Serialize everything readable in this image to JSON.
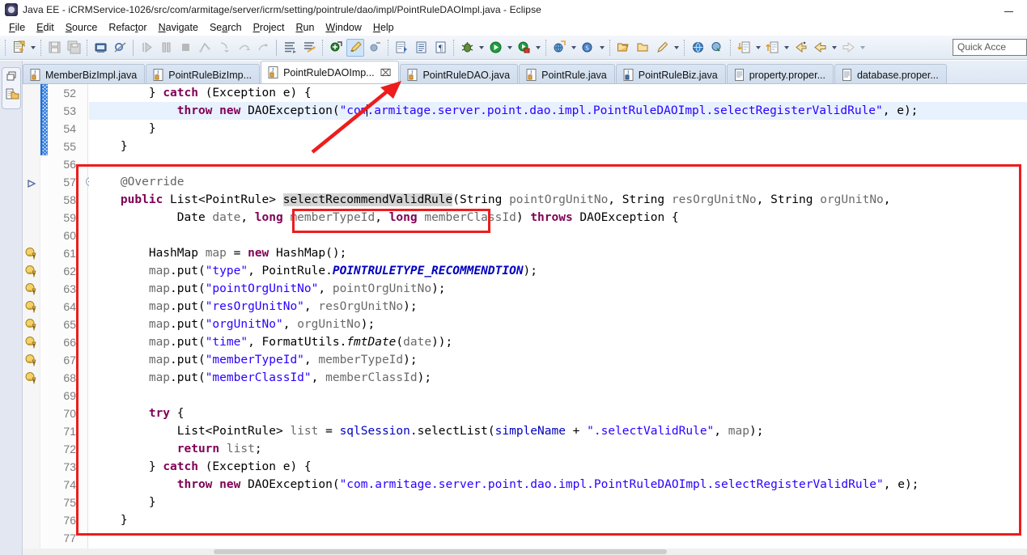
{
  "window": {
    "title": "Java EE - iCRMService-1026/src/com/armitage/server/icrm/setting/pointrule/dao/impl/PointRuleDAOImpl.java - Eclipse",
    "app_icon": "eclipse-icon",
    "minimize_label": "–"
  },
  "menu": {
    "items": [
      {
        "label": "File"
      },
      {
        "label": "Edit"
      },
      {
        "label": "Source"
      },
      {
        "label": "Refactor"
      },
      {
        "label": "Navigate"
      },
      {
        "label": "Search"
      },
      {
        "label": "Project"
      },
      {
        "label": "Run"
      },
      {
        "label": "Window"
      },
      {
        "label": "Help"
      }
    ]
  },
  "toolbar": {
    "quick_access_placeholder": "Quick Acce",
    "buttons": [
      {
        "name": "new-wizard",
        "icon": "new-file-icon",
        "dropdown": true,
        "enabled": true
      },
      {
        "name": "save",
        "icon": "save-icon",
        "dropdown": false,
        "enabled": false
      },
      {
        "name": "save-all",
        "icon": "save-all-icon",
        "dropdown": false,
        "enabled": false
      },
      {
        "name": "print",
        "icon": "print-icon",
        "dropdown": false,
        "enabled": true
      },
      {
        "name": "toggle-breakpoint",
        "icon": "skip-breakpoints-icon",
        "dropdown": false,
        "enabled": true
      },
      {
        "name": "resume",
        "icon": "resume-icon",
        "dropdown": false,
        "enabled": false
      },
      {
        "name": "suspend",
        "icon": "suspend-icon",
        "dropdown": false,
        "enabled": false
      },
      {
        "name": "terminate",
        "icon": "terminate-icon",
        "dropdown": false,
        "enabled": false
      },
      {
        "name": "disconnect",
        "icon": "disconnect-icon",
        "dropdown": false,
        "enabled": false
      },
      {
        "name": "step-into",
        "icon": "step-into-icon",
        "dropdown": false,
        "enabled": false
      },
      {
        "name": "step-over",
        "icon": "step-over-icon",
        "dropdown": false,
        "enabled": false
      },
      {
        "name": "step-return",
        "icon": "step-return-icon",
        "dropdown": false,
        "enabled": false
      },
      {
        "name": "open-task",
        "icon": "task-icon",
        "dropdown": false,
        "enabled": true
      },
      {
        "name": "new-task",
        "icon": "new-task-icon",
        "dropdown": false,
        "enabled": true
      },
      {
        "name": "open-mylyn-task",
        "icon": "mylyn-task-icon",
        "dropdown": false,
        "enabled": true
      },
      {
        "name": "activate-task",
        "icon": "highlight-icon",
        "dropdown": false,
        "enabled": true,
        "selected": true
      },
      {
        "name": "deactivate-task",
        "icon": "deactivate-icon",
        "dropdown": false,
        "enabled": true
      },
      {
        "name": "new-java-project",
        "icon": "java-project-icon",
        "dropdown": false,
        "enabled": true
      },
      {
        "name": "new-java-package",
        "icon": "package-icon",
        "dropdown": false,
        "enabled": true
      },
      {
        "name": "new-java-type",
        "icon": "type-icon",
        "dropdown": false,
        "enabled": true
      },
      {
        "name": "debug",
        "icon": "debug-bug-icon",
        "dropdown": true,
        "enabled": true
      },
      {
        "name": "run",
        "icon": "run-play-icon",
        "dropdown": true,
        "enabled": true
      },
      {
        "name": "run-external-tools",
        "icon": "external-tools-icon",
        "dropdown": true,
        "enabled": true
      },
      {
        "name": "new-server",
        "icon": "new-server-icon",
        "dropdown": true,
        "enabled": true
      },
      {
        "name": "new-ejb",
        "icon": "new-ejb-icon",
        "dropdown": true,
        "enabled": true
      },
      {
        "name": "open-type",
        "icon": "open-type-icon",
        "dropdown": false,
        "enabled": true
      },
      {
        "name": "open-folder",
        "icon": "open-folder-icon",
        "dropdown": false,
        "enabled": true
      },
      {
        "name": "search-ref",
        "icon": "pencil-search-icon",
        "dropdown": true,
        "enabled": true
      },
      {
        "name": "open-web-browser",
        "icon": "web-browser-icon",
        "dropdown": false,
        "enabled": true
      },
      {
        "name": "open-perspective",
        "icon": "perspective-icon",
        "dropdown": false,
        "enabled": true
      },
      {
        "name": "next-annotation",
        "icon": "next-annotation-icon",
        "dropdown": true,
        "enabled": true
      },
      {
        "name": "previous-annotation",
        "icon": "prev-annotation-icon",
        "dropdown": true,
        "enabled": true
      },
      {
        "name": "last-edit-location",
        "icon": "last-edit-icon",
        "dropdown": false,
        "enabled": true
      },
      {
        "name": "back",
        "icon": "back-arrow-icon",
        "dropdown": true,
        "enabled": true
      },
      {
        "name": "forward",
        "icon": "forward-arrow-icon",
        "dropdown": true,
        "enabled": false
      }
    ]
  },
  "editor_tabs": [
    {
      "label": "MemberBizImpl.java",
      "icon": "java-file-icon",
      "active": false,
      "dirty": false
    },
    {
      "label": "PointRuleBizImp...",
      "icon": "java-file-icon",
      "active": false,
      "dirty": false
    },
    {
      "label": "PointRuleDAOImp...",
      "icon": "java-file-icon",
      "active": true,
      "dirty": false,
      "close": "⌧"
    },
    {
      "label": "PointRuleDAO.java",
      "icon": "java-file-icon",
      "active": false,
      "dirty": false
    },
    {
      "label": "PointRule.java",
      "icon": "java-file-icon",
      "active": false,
      "dirty": false
    },
    {
      "label": "PointRuleBiz.java",
      "icon": "java-file-icon",
      "active": false,
      "dirty": false
    },
    {
      "label": "property.proper...",
      "icon": "properties-file-icon",
      "active": false,
      "dirty": false
    },
    {
      "label": "database.proper...",
      "icon": "properties-file-icon",
      "active": false,
      "dirty": false
    }
  ],
  "editor": {
    "first_line": 52,
    "last_line": 77,
    "highlighted_line": 53,
    "selected_occurrence": "selectRecommendValidRule",
    "fold_lines": [
      57
    ],
    "warning_lines": [
      61,
      62,
      63,
      64,
      65,
      66,
      67,
      68
    ],
    "overview_marker_lines": [
      52,
      53,
      54,
      55
    ],
    "lines": [
      {
        "n": 52,
        "text": "        } catch (Exception e) {"
      },
      {
        "n": 53,
        "text": "            throw new DAOException(\"com.armitage.server.point.dao.impl.PointRuleDAOImpl.selectRegisterValidRule\", e);"
      },
      {
        "n": 54,
        "text": "        }"
      },
      {
        "n": 55,
        "text": "    }"
      },
      {
        "n": 56,
        "text": ""
      },
      {
        "n": 57,
        "text": "    @Override"
      },
      {
        "n": 58,
        "text": "    public List<PointRule> selectRecommendValidRule(String pointOrgUnitNo, String resOrgUnitNo, String orgUnitNo,"
      },
      {
        "n": 59,
        "text": "            Date date, long memberTypeId, long memberClassId) throws DAOException {"
      },
      {
        "n": 60,
        "text": ""
      },
      {
        "n": 61,
        "text": "        HashMap map = new HashMap();"
      },
      {
        "n": 62,
        "text": "        map.put(\"type\", PointRule.POINTRULETYPE_RECOMMENDTION);"
      },
      {
        "n": 63,
        "text": "        map.put(\"pointOrgUnitNo\", pointOrgUnitNo);"
      },
      {
        "n": 64,
        "text": "        map.put(\"resOrgUnitNo\", resOrgUnitNo);"
      },
      {
        "n": 65,
        "text": "        map.put(\"orgUnitNo\", orgUnitNo);"
      },
      {
        "n": 66,
        "text": "        map.put(\"time\", FormatUtils.fmtDate(date));"
      },
      {
        "n": 67,
        "text": "        map.put(\"memberTypeId\", memberTypeId);"
      },
      {
        "n": 68,
        "text": "        map.put(\"memberClassId\", memberClassId);"
      },
      {
        "n": 69,
        "text": ""
      },
      {
        "n": 70,
        "text": "        try {"
      },
      {
        "n": 71,
        "text": "            List<PointRule> list = sqlSession.selectList(simpleName + \".selectValidRule\", map);"
      },
      {
        "n": 72,
        "text": "            return list;"
      },
      {
        "n": 73,
        "text": "        } catch (Exception e) {"
      },
      {
        "n": 74,
        "text": "            throw new DAOException(\"com.armitage.server.point.dao.impl.PointRuleDAOImpl.selectRegisterValidRule\", e);"
      },
      {
        "n": 75,
        "text": "        }"
      },
      {
        "n": 76,
        "text": "    }"
      },
      {
        "n": 77,
        "text": ""
      }
    ]
  },
  "annotations": {
    "color": "#ee1c1c",
    "outer_box": {
      "label": "method-body-highlight"
    },
    "inner_box": {
      "label": "method-name-highlight"
    },
    "arrow": {
      "label": "pointer-arrow-to-line-53"
    }
  }
}
